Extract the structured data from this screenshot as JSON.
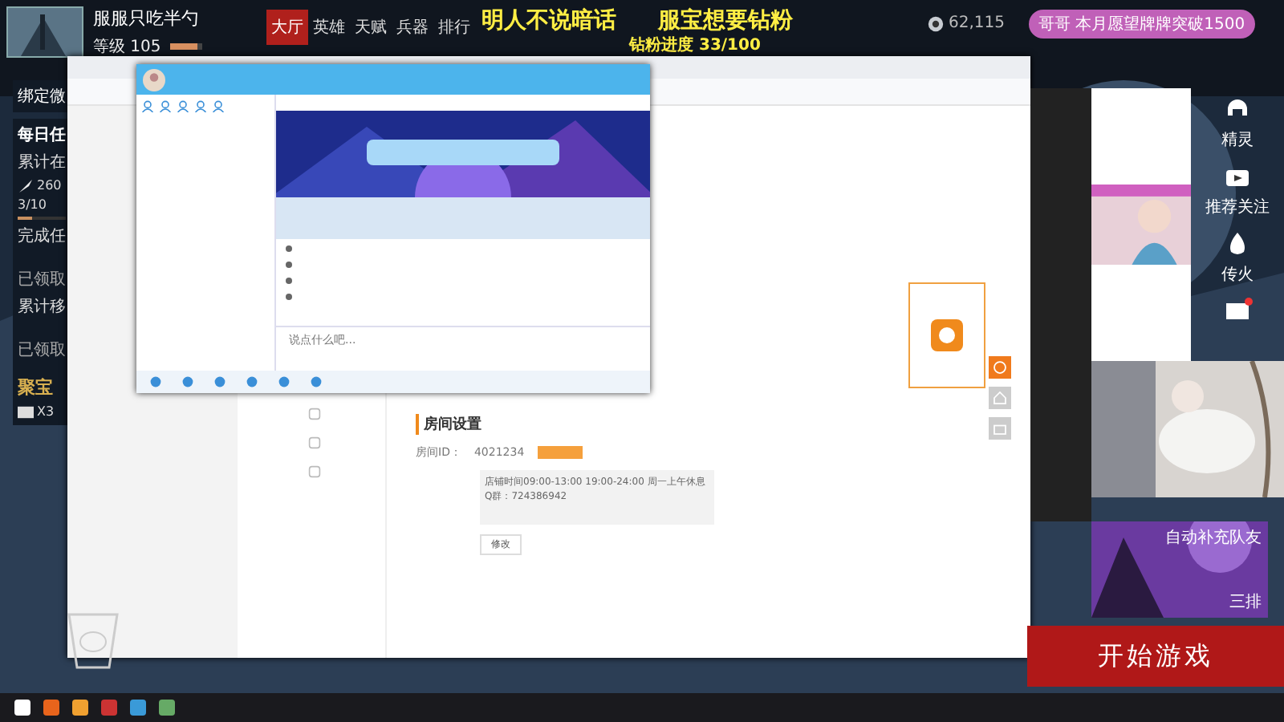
{
  "player": {
    "name": "服服只吃半勺",
    "level_text": "等级 105",
    "exp": {
      "level": 0.85
    }
  },
  "game_tabs": [
    {
      "label": "大厅",
      "selected": true
    },
    {
      "label": "英雄",
      "selected": false
    },
    {
      "label": "天赋",
      "selected": false
    },
    {
      "label": "兵器",
      "selected": false
    },
    {
      "label": "排行",
      "selected": false
    }
  ],
  "overlay": {
    "slogan_1": "明人不说暗话",
    "slogan_2": "服宝想要钻粉",
    "progress": "钻粉进度 33/100",
    "currency": "62,115",
    "wish": "哥哥 本月愿望牌牌突破1500"
  },
  "tasks": {
    "bind": "绑定微",
    "daily_title": "每日任",
    "task_1": "累计在",
    "reward": "260",
    "count": "3/10",
    "progress": {
      "level": 0.3
    },
    "task_2": "完成任",
    "claimed_1": "已领取",
    "task_3": "累计移",
    "claimed_2": "已领取",
    "treasure": "聚宝",
    "treasure_count": "X3"
  },
  "chat_window": {
    "placeholder": "说点什么吧..."
  },
  "settings": {
    "heading": "房间设置",
    "room_label": "房间ID：",
    "room_id": "4021234",
    "announcement": "店铺时间09:00-13:00 19:00-24:00 周一上午休息 Q群：724386942",
    "edit": "修改"
  },
  "side_menu": [
    {
      "label": "精灵"
    },
    {
      "label": "推荐关注"
    },
    {
      "label": "传火"
    }
  ],
  "game": {
    "auto_fill": "自动补充队友",
    "mode": "三排",
    "start": "开始游戏"
  }
}
